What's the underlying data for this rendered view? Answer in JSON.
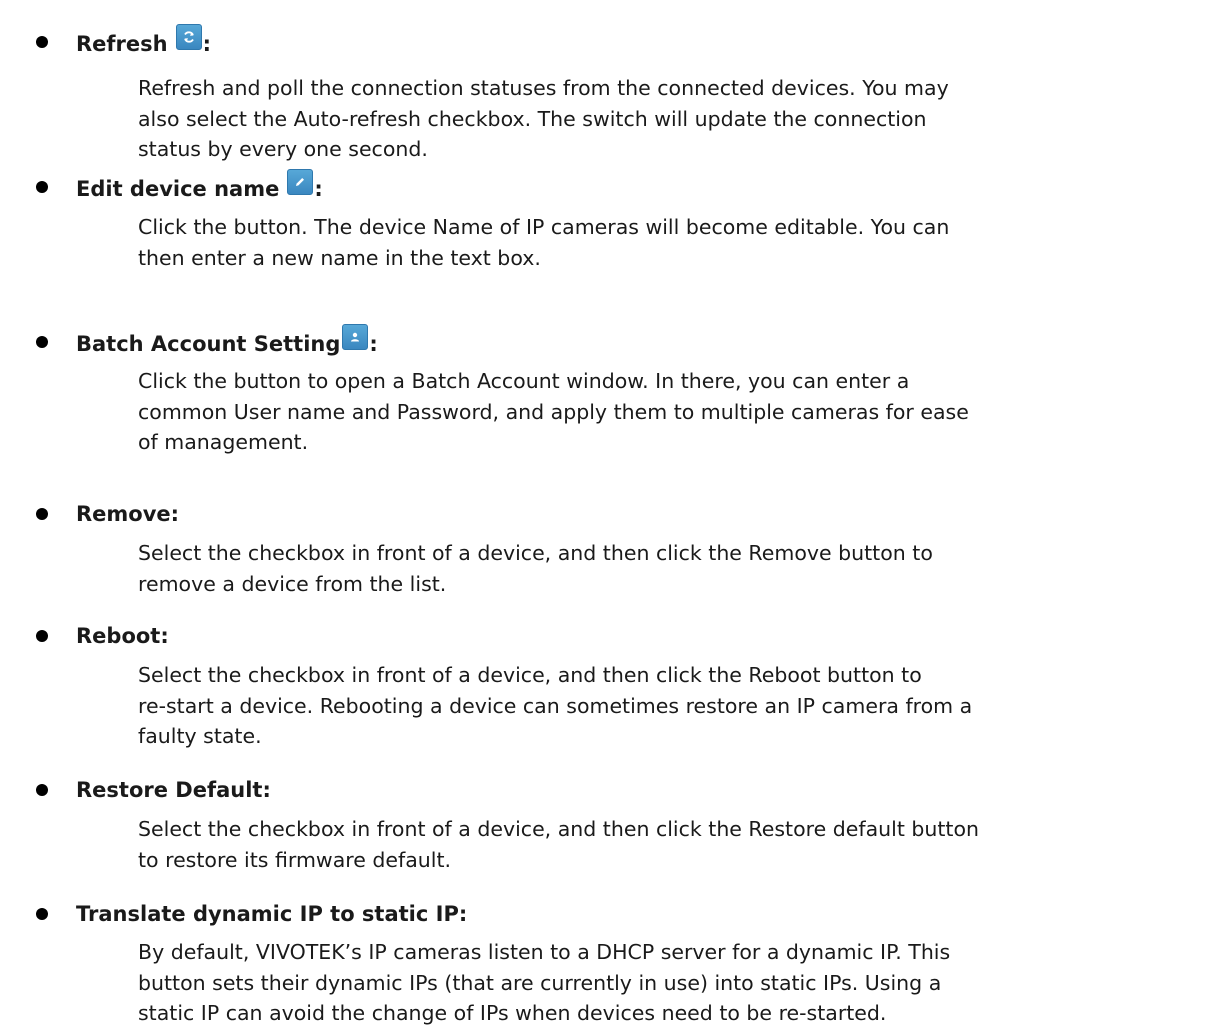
{
  "items": [
    {
      "title": "Refresh",
      "icon": "refresh-icon",
      "colon": ":",
      "text": "Refresh and poll the connection statuses from the connected devices. You may\nalso select the Auto-refresh checkbox. The switch will update the connection\nstatus by every one second."
    },
    {
      "title": "Edit device name",
      "icon": "pencil-icon",
      "colon": ":",
      "text": "Click the button. The device Name of IP cameras will become editable. You can\nthen enter a new name in the text box."
    },
    {
      "title": "Batch Account Setting",
      "icon": "user-icon",
      "colon": ":",
      "text": "Click the button to open a Batch Account window. In there, you can enter a\ncommon User name and Password, and apply them to multiple cameras for ease\nof management."
    },
    {
      "title": "Remove:",
      "text": "Select the checkbox in front of a device, and then click the Remove button to\nremove a device from the list."
    },
    {
      "title": "Reboot:",
      "text": "Select the checkbox in front of a device, and then click the Reboot button to\nre-start a device. Rebooting a device can sometimes restore an IP camera from a\nfaulty state."
    },
    {
      "title": "Restore Default:",
      "text": "Select the checkbox in front of a device, and then click the Restore default button\nto restore its firmware default."
    },
    {
      "title": "Translate dynamic IP to static IP:",
      "text": "By default, VIVOTEK’s IP cameras listen to a DHCP server for a dynamic IP. This\nbutton sets their dynamic IPs (that are currently in use) into static IPs. Using a\nstatic IP can avoid the change of IPs when devices need to be re-started."
    }
  ],
  "colors": {
    "button": "#3a87c0",
    "text": "#1a1a1a"
  }
}
